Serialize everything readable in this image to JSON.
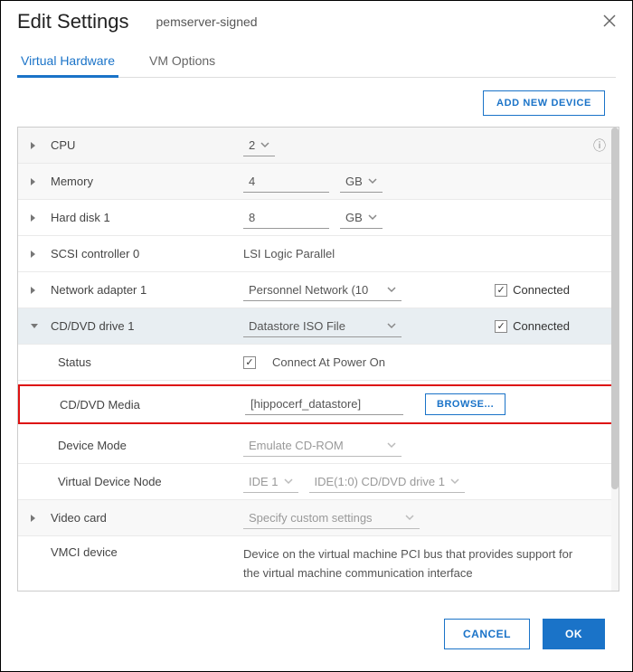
{
  "dialog": {
    "title": "Edit Settings",
    "subtitle": "pemserver-signed"
  },
  "tabs": {
    "hardware": "Virtual Hardware",
    "options": "VM Options"
  },
  "toolbar": {
    "add_device": "ADD NEW DEVICE"
  },
  "hw": {
    "cpu": {
      "label": "CPU",
      "value": "2"
    },
    "memory": {
      "label": "Memory",
      "value": "4",
      "unit": "GB"
    },
    "hdd1": {
      "label": "Hard disk 1",
      "value": "8",
      "unit": "GB"
    },
    "scsi0": {
      "label": "SCSI controller 0",
      "value": "LSI Logic Parallel"
    },
    "net1": {
      "label": "Network adapter 1",
      "value": "Personnel Network (10",
      "connected_label": "Connected"
    },
    "cdrom1": {
      "label": "CD/DVD drive 1",
      "value": "Datastore ISO File",
      "connected_label": "Connected",
      "status_label": "Status",
      "status_value": "Connect At Power On",
      "media_label": "CD/DVD Media",
      "media_value": "[hippocerf_datastore]",
      "browse": "BROWSE...",
      "mode_label": "Device Mode",
      "mode_value": "Emulate CD-ROM",
      "vdn_label": "Virtual Device Node",
      "vdn_bus": "IDE 1",
      "vdn_slot": "IDE(1:0) CD/DVD drive 1"
    },
    "video": {
      "label": "Video card",
      "value": "Specify custom settings"
    },
    "vmci": {
      "label": "VMCI device",
      "desc": "Device on the virtual machine PCI bus that provides support for the virtual machine communication interface"
    }
  },
  "footer": {
    "cancel": "CANCEL",
    "ok": "OK"
  }
}
